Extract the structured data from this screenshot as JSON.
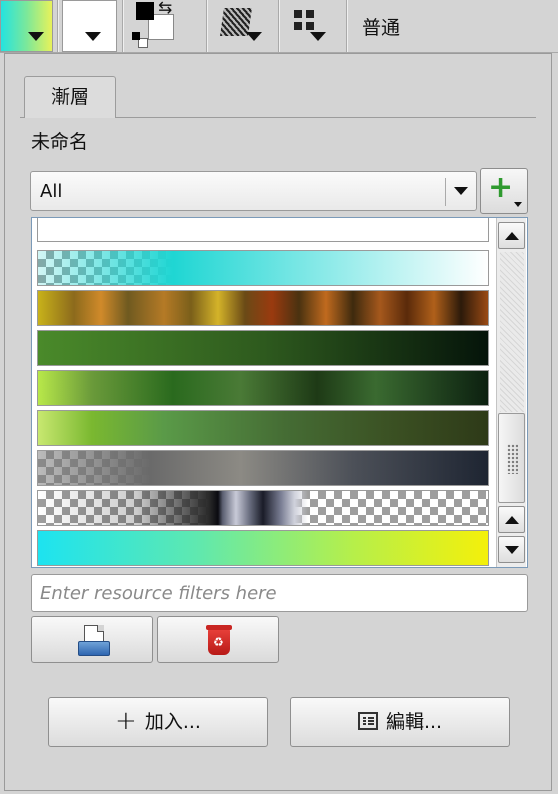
{
  "toolbar": {
    "gradient_swatch_icon": "gradient-preview",
    "foreground_swatch_icon": "white-swatch",
    "fg_bg_icon": "foreground-background-swap",
    "pattern_icon": "pattern-preset",
    "brush_icon": "brush-preset-grid",
    "blend_mode": "普通"
  },
  "panel": {
    "tab_label": "漸層",
    "preset_name": "未命名",
    "tag_filter": {
      "selected": "All",
      "add_icon": "green-plus-icon"
    },
    "gradients": [
      {
        "name": "white-transparent",
        "css": "linear-gradient(90deg,#ffffff,#ffffff)"
      },
      {
        "name": "cyan-to-transparent",
        "css": "linear-gradient(90deg,rgba(29,210,208,0.2) 0%,#1fd6d3 30%,rgba(255,255,255,1) 100%)",
        "checker": true
      },
      {
        "name": "autumn-stripes",
        "css": "linear-gradient(90deg,#c8b21a 0%,#8c6a1c 8%,#d08a2a 14%,#6f5a20 20%,#b57a26 28%,#7a5f1a 34%,#d4b329 40%,#6a4a16 46%,#9a3a0f 52%,#4a3210 58%,#c06a1e 64%,#3e2a0e 70%,#a5581c 76%,#5a2a0a 82%,#b0601a 88%,#2c1a0a 94%,#9a4a14 100%)"
      },
      {
        "name": "forest-dark",
        "css": "linear-gradient(90deg,#4a8a2a 0%,#2e5a1e 50%,#05140a 100%)"
      },
      {
        "name": "green-spring",
        "css": "linear-gradient(90deg,#b8e84a 0%,#6a9a3a 12%,#2a6a1e 30%,#4a7a36 45%,#1e3a16 62%,#3a6a30 75%,#0c2010 100%)"
      },
      {
        "name": "olive-fade",
        "css": "linear-gradient(90deg,#c8e870 0%,#7ab830 12%,#5a9a48 28%,#456c34 55%,#3a4f22 80%,#2e3a18 100%)"
      },
      {
        "name": "gray-to-navy",
        "css": "linear-gradient(90deg,rgba(120,120,120,0.5) 0%,#6a6a6a 25%,#8c8a84 45%,#4c5058 70%,#1e2532 100%)",
        "checker": true
      },
      {
        "name": "metallic-chrome",
        "css": "linear-gradient(90deg,rgba(0,0,0,0) 0%,rgba(0,0,0,0.2) 22%,#2a2a2a 38%,#0a0a10 40%,#5a5e70 41%,#c8cad8 44%,#6a6e80 47%,#1a1c28 50%,#7a7e94 54%,#d0d2dc 57%,rgba(0,0,0,0) 60%,rgba(0,0,0,0) 100%)",
        "checker": true
      },
      {
        "name": "cyan-to-yellow",
        "css": "linear-gradient(90deg,#1de3f0 0%,#5ee8b0 35%,#b6ef4a 70%,#f4f00a 100%)"
      }
    ],
    "filter_placeholder": "Enter resource filters here",
    "filter_value": "",
    "import_icon": "import-resource-icon",
    "delete_icon": "delete-resource-icon",
    "add_button": "加入...",
    "edit_button": "編輯..."
  }
}
